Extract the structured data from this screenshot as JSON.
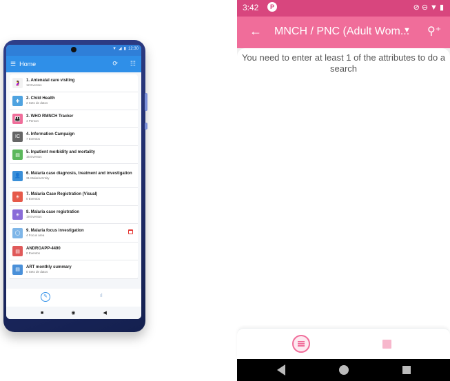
{
  "mockup": {
    "status_time": "12:30",
    "appbar_title": "Home",
    "items": [
      {
        "title": "1. Antenatal care visiting",
        "subtitle": "12 Eventos",
        "icon": "pregnant-woman-icon",
        "color": "#f2f2f2",
        "glyph": "🤰"
      },
      {
        "title": "2. Child Health",
        "subtitle": "2 Sets de datos",
        "icon": "child-health-icon",
        "color": "#4fa3e0",
        "glyph": "✚"
      },
      {
        "title": "3. WHO RMNCH Tracker",
        "subtitle": "4 Person",
        "icon": "family-icon",
        "color": "#f06d9a",
        "glyph": "👪"
      },
      {
        "title": "4. Information Campaign",
        "subtitle": "7 Eventos",
        "icon": "ic-logo-icon",
        "color": "#666666",
        "glyph": "IC"
      },
      {
        "title": "5. Inpatient morbidity and mortality",
        "subtitle": "16 Eventos",
        "icon": "hospital-icon",
        "color": "#5cb85c",
        "glyph": "▤"
      },
      {
        "title": "6. Malaria case diagnosis, treatment and investigation",
        "subtitle": "31 Malaria Entity",
        "icon": "person-icon",
        "color": "#3a8fd8",
        "glyph": "👤"
      },
      {
        "title": "7. Malaria Case Registration (Visual)",
        "subtitle": "0 Eventos",
        "icon": "mosquito-icon",
        "color": "#e65a4a",
        "glyph": "✳"
      },
      {
        "title": "8. Malaria case registration",
        "subtitle": "19 Eventos",
        "icon": "mosquito-icon",
        "color": "#8a6cd8",
        "glyph": "✳"
      },
      {
        "title": "9. Malaria focus investigation",
        "subtitle": "4 Focus area",
        "icon": "focus-area-icon",
        "color": "#7fb6e8",
        "glyph": "◯"
      },
      {
        "title": "ANDROAPP-4490",
        "subtitle": "0 Eventos",
        "icon": "document-icon",
        "color": "#e05a5a",
        "glyph": "▤"
      },
      {
        "title": "ART monthly summary",
        "subtitle": "0 Sets de datos",
        "icon": "document-icon",
        "color": "#4a90d9",
        "glyph": "▤"
      }
    ]
  },
  "screen": {
    "status_time": "3:42",
    "status_notification": "P",
    "title": "MNCH / PNC (Adult Wom...",
    "message": "You need to enter at least 1 of the attributes to do a search"
  },
  "colors": {
    "accent_pink": "#f06d9a",
    "status_pink": "#d8467e",
    "mockup_blue": "#2f8fe8"
  }
}
